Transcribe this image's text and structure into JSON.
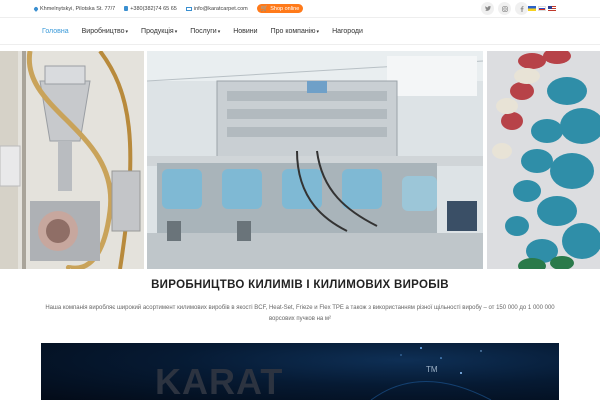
{
  "topbar": {
    "address": "Khmelnytskyi, Pilotska St. 77/7",
    "phone": "+380(382)74 65 65",
    "email": "info@karatcarpet.com",
    "shop_label": "Shop online",
    "socials": [
      "twitter-icon",
      "instagram-icon",
      "facebook-icon"
    ],
    "languages": [
      "ua",
      "ru",
      "en"
    ]
  },
  "nav": {
    "items": [
      {
        "label": "Головна",
        "active": true,
        "dropdown": false
      },
      {
        "label": "Виробництво",
        "active": false,
        "dropdown": true
      },
      {
        "label": "Продукція",
        "active": false,
        "dropdown": true
      },
      {
        "label": "Послуги",
        "active": false,
        "dropdown": true
      },
      {
        "label": "Новини",
        "active": false,
        "dropdown": false
      },
      {
        "label": "Про компанію",
        "active": false,
        "dropdown": true
      },
      {
        "label": "Нагороди",
        "active": false,
        "dropdown": false
      }
    ]
  },
  "main": {
    "title": "ВИРОБНИЦТВО КИЛИМІВ І КИЛИМОВИХ ВИРОБІВ",
    "description": "Наша компанія виробляє широкий асортимент килимових виробів в якості BCF, Heat-Set, Frieze и Flex TPE а також з використанням різної щільності виробу – от 150 000 до 1 000 000 ворсових пучков на м²"
  },
  "banner": {
    "logo_text": "KARAT",
    "tm": "TM"
  },
  "colors": {
    "accent": "#3a9ad9",
    "shop": "#ff7a1a",
    "banner_bg": "#061a33"
  }
}
